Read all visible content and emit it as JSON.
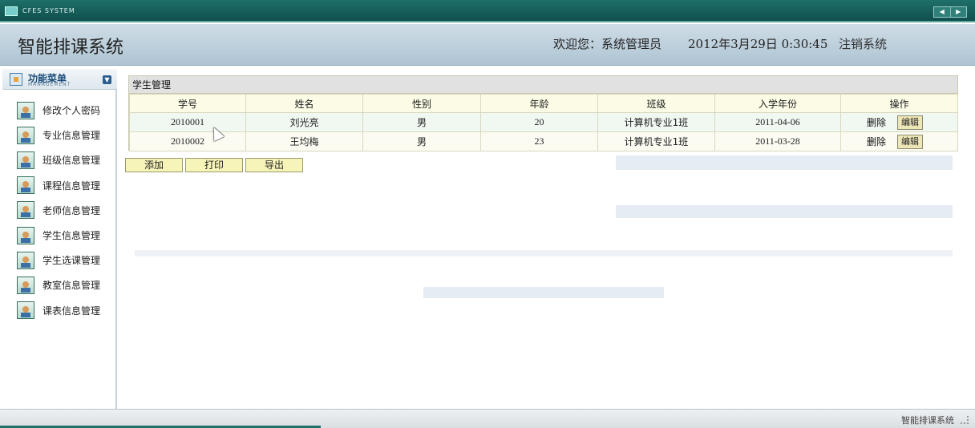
{
  "window": {
    "caption": "CFES SYSTEM",
    "nav_prev": "◀",
    "nav_next": "▶"
  },
  "header": {
    "title": "智能排课系统",
    "welcome": "欢迎您：系统管理员",
    "datetime": "2012年3月29日 0:30:45",
    "logout": "注销系统"
  },
  "sidebar": {
    "title": "功能菜单",
    "subtitle": "MANAGEMENT",
    "items": [
      {
        "label": "修改个人密码"
      },
      {
        "label": "专业信息管理"
      },
      {
        "label": "班级信息管理"
      },
      {
        "label": "课程信息管理"
      },
      {
        "label": "老师信息管理"
      },
      {
        "label": "学生信息管理"
      },
      {
        "label": "学生选课管理"
      },
      {
        "label": "教室信息管理"
      },
      {
        "label": "课表信息管理"
      }
    ]
  },
  "panel": {
    "title": "学生管理",
    "columns": [
      "学号",
      "姓名",
      "性别",
      "年龄",
      "班级",
      "入学年份",
      "操作"
    ],
    "rows": [
      {
        "id": "2010001",
        "name": "刘光亮",
        "gender": "男",
        "age": "20",
        "class": "计算机专业1班",
        "year": "2011-04-06",
        "delete": "删除",
        "edit": "编辑"
      },
      {
        "id": "2010002",
        "name": "王均梅",
        "gender": "男",
        "age": "23",
        "class": "计算机专业1班",
        "year": "2011-03-28",
        "delete": "删除",
        "edit": "编辑"
      }
    ]
  },
  "actions": {
    "add": "添加",
    "print": "打印",
    "export": "导出"
  },
  "status": {
    "text": "智能排课系统"
  }
}
